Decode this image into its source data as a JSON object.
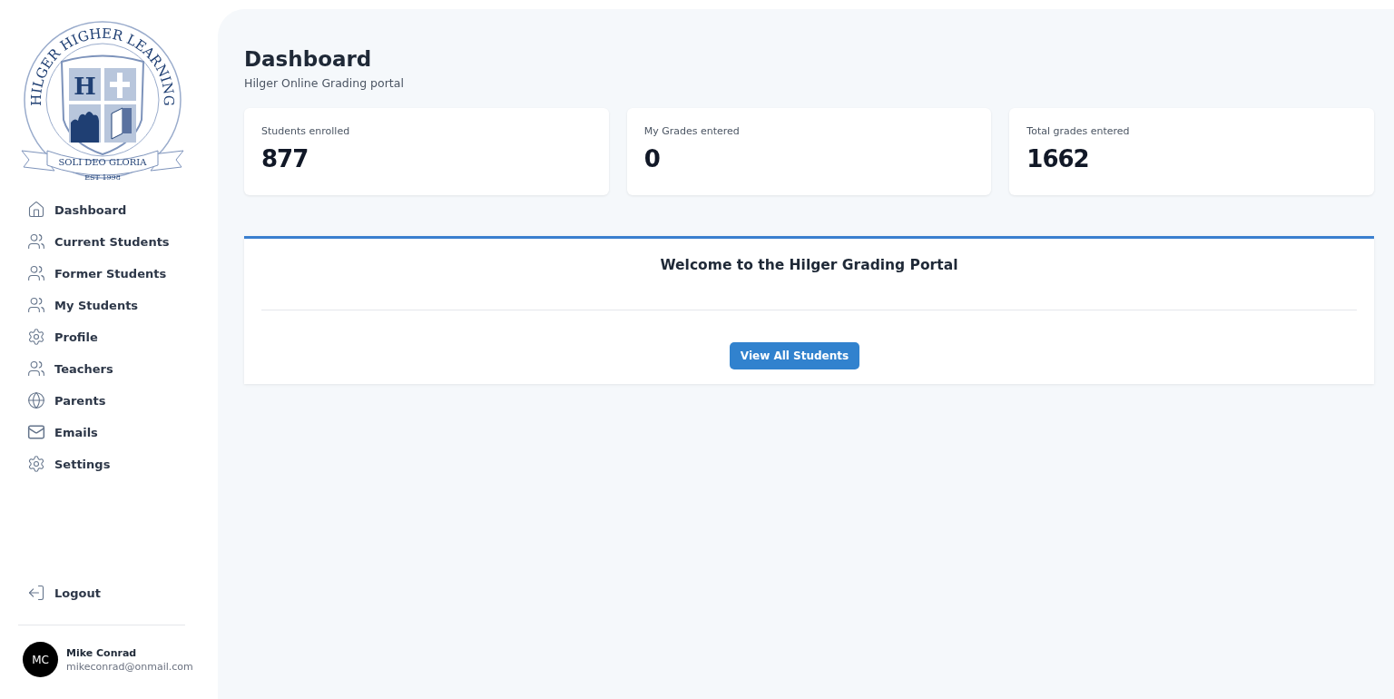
{
  "logo": {
    "arc_text": "HILGER HIGHER LEARNING",
    "letter": "H",
    "motto": "SOLI DEO GLORIA",
    "established": "EST 1998"
  },
  "sidebar": {
    "items": [
      {
        "kind": "home",
        "label": "Dashboard"
      },
      {
        "kind": "users",
        "label": "Current Students"
      },
      {
        "kind": "users",
        "label": "Former Students"
      },
      {
        "kind": "users",
        "label": "My Students"
      },
      {
        "kind": "gear",
        "label": "Profile"
      },
      {
        "kind": "users",
        "label": "Teachers"
      },
      {
        "kind": "globe",
        "label": "Parents"
      },
      {
        "kind": "mail",
        "label": "Emails"
      },
      {
        "kind": "gear",
        "label": "Settings"
      }
    ],
    "logout": "Logout",
    "user": {
      "initials": "MC",
      "name": "Mike Conrad",
      "email": "mikeconrad@onmail.com"
    }
  },
  "header": {
    "title": "Dashboard",
    "subtitle": "Hilger Online Grading portal"
  },
  "stats": [
    {
      "label": "Students enrolled",
      "value": "877"
    },
    {
      "label": "My Grades entered",
      "value": "0"
    },
    {
      "label": "Total grades entered",
      "value": "1662"
    }
  ],
  "welcome": {
    "title": "Welcome to the Hilger Grading Portal",
    "button": "View All Students"
  }
}
